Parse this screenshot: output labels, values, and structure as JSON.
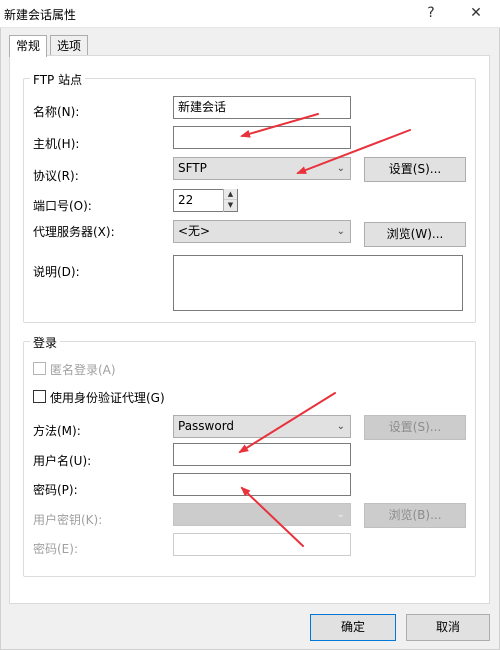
{
  "window": {
    "title": "新建会话属性",
    "help_glyph": "?",
    "close_glyph": "✕"
  },
  "tabs": [
    {
      "label": "常规",
      "active": true
    },
    {
      "label": "选项",
      "active": false
    }
  ],
  "ftp_site": {
    "group_title": "FTP 站点",
    "name_label": "名称(N):",
    "name_value": "新建会话",
    "host_label": "主机(H):",
    "host_value": "",
    "protocol_label": "协议(R):",
    "protocol_value": "SFTP",
    "protocol_settings_button": "设置(S)...",
    "port_label": "端口号(O):",
    "port_value": "22",
    "proxy_label": "代理服务器(X):",
    "proxy_value": "<无>",
    "proxy_browse_button": "浏览(W)...",
    "description_label": "说明(D):",
    "description_value": ""
  },
  "login": {
    "group_title": "登录",
    "anonymous_label": "匿名登录(A)",
    "anonymous_checked": false,
    "agent_label": "使用身份验证代理(G)",
    "agent_checked": false,
    "method_label": "方法(M):",
    "method_value": "Password",
    "method_settings_button": "设置(S)...",
    "username_label": "用户名(U):",
    "username_value": "",
    "password_label": "密码(P):",
    "password_value": "",
    "user_key_label": "用户密钥(K):",
    "user_key_value": "",
    "key_browse_button": "浏览(B)...",
    "passphrase_label": "密码(E):",
    "passphrase_value": ""
  },
  "footer": {
    "ok_button": "确定",
    "cancel_button": "取消"
  },
  "colors": {
    "annotation_arrow": "#e8323c",
    "focus_border": "#0078d7"
  }
}
